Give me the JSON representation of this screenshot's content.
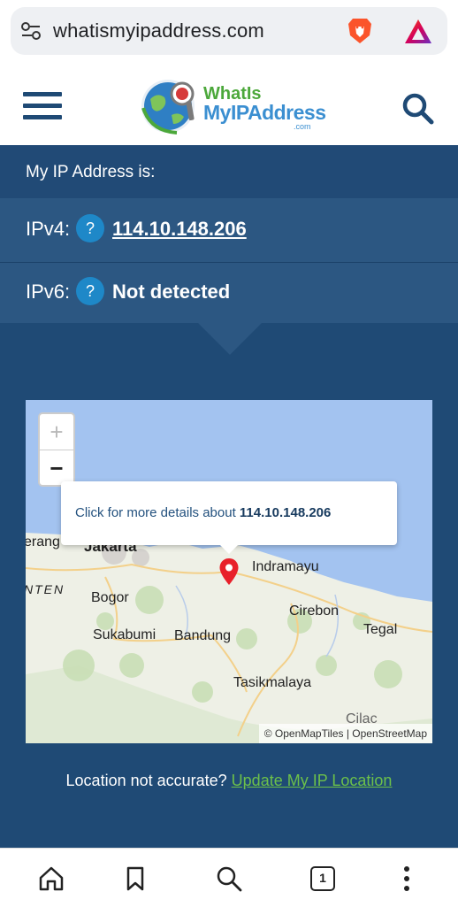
{
  "browser": {
    "url": "whatismyipaddress.com",
    "tab_count": "1"
  },
  "header": {
    "logo_line1": "WhatIs",
    "logo_line2": "MyIPAddress",
    "logo_suffix": ".com"
  },
  "ip_panel": {
    "label": "My IP Address is:",
    "ipv4_label": "IPv4:",
    "ipv4_value": "114.10.148.206",
    "ipv6_label": "IPv6:",
    "ipv6_value": "Not detected",
    "help_symbol": "?"
  },
  "map": {
    "zoom_in": "+",
    "zoom_out": "−",
    "popup_prefix": "Click for more details about ",
    "popup_ip": "114.10.148.206",
    "places": {
      "serang": "erang",
      "jakarta": "Jakarta",
      "banten": "NTEN",
      "bogor": "Bogor",
      "indramayu": "Indramayu",
      "cirebon": "Cirebon",
      "tegal": "Tegal",
      "sukabumi": "Sukabumi",
      "bandung": "Bandung",
      "tasikmalaya": "Tasikmalaya",
      "cilacap": "Cilac"
    },
    "attribution": "© OpenMapTiles | OpenStreetMap"
  },
  "location": {
    "question": "Location not accurate? ",
    "link": "Update My IP Location"
  },
  "colors": {
    "brand_blue": "#1f4a75",
    "link_green": "#6cc04a",
    "help_blue": "#1e88c8"
  }
}
